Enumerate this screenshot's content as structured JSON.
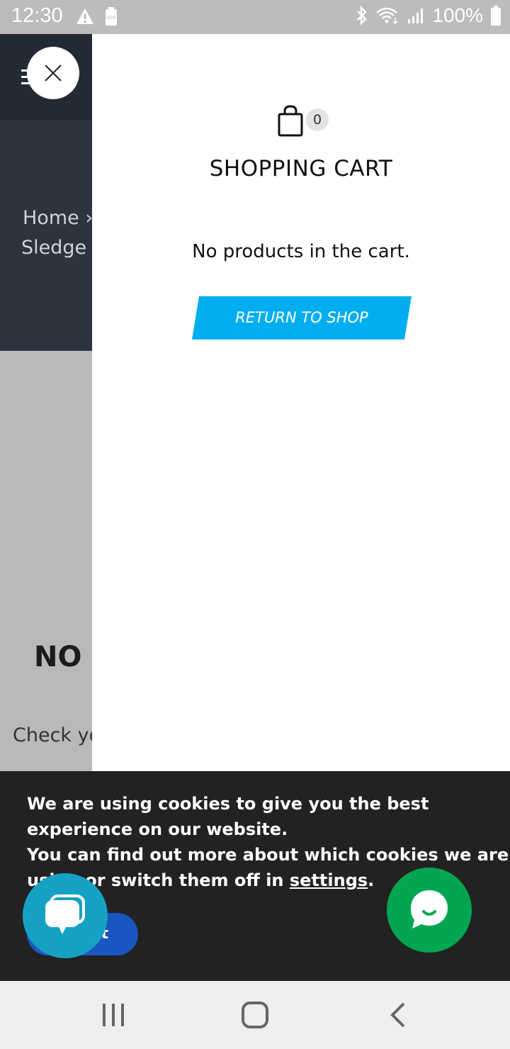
{
  "status_bar": {
    "time": "12:30",
    "battery_text": "100%",
    "icons": [
      "warning-icon",
      "battery-saver-icon",
      "bluetooth-icon",
      "wifi-icon",
      "signal-icon",
      "battery-icon"
    ]
  },
  "background_page": {
    "breadcrumb_home": "Home ›",
    "breadcrumb_current": "Sledge I",
    "heading": "NO",
    "text": "Check yo"
  },
  "cart": {
    "count": "0",
    "title": "SHOPPING CART",
    "empty_message": "No products in the cart.",
    "return_button": "RETURN TO SHOP"
  },
  "cookie_banner": {
    "line1": "We are using cookies to give you the best",
    "line2": "experience on our website.",
    "line3": "You can find out more about which cookies we are",
    "line4_prefix": "using or switch them off in ",
    "line4_link": "settings",
    "line4_suffix": ".",
    "accept_label": "Accept"
  },
  "colors": {
    "status_bar": "#bdbcbd",
    "header_dark": "#242a35",
    "hero_dark": "#2d3440",
    "cta_blue": "#00aeef",
    "cookie_bg": "#222222",
    "accept_blue": "#1a56c0",
    "chat_left": "#16a1c4",
    "chat_right": "#02a650"
  }
}
